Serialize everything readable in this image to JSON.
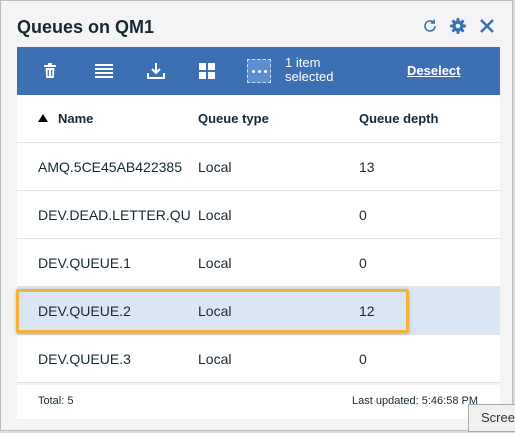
{
  "panel": {
    "title": "Queues on QM1",
    "icons": {
      "refresh": "refresh-icon",
      "settings": "gear-icon",
      "close": "close-icon"
    }
  },
  "toolbar": {
    "selection_text": "1 item selected",
    "deselect_label": "Deselect",
    "icons": [
      "trash-icon",
      "list-icon",
      "download-icon",
      "grid-icon",
      "more-icon"
    ]
  },
  "table": {
    "columns": [
      "Name",
      "Queue type",
      "Queue depth"
    ],
    "rows": [
      {
        "name": "AMQ.5CE45AB422385",
        "type": "Local",
        "depth": "13"
      },
      {
        "name": "DEV.DEAD.LETTER.QU",
        "type": "Local",
        "depth": "0"
      },
      {
        "name": "DEV.QUEUE.1",
        "type": "Local",
        "depth": "0"
      },
      {
        "name": "DEV.QUEUE.2",
        "type": "Local",
        "depth": "12",
        "selected": true
      },
      {
        "name": "DEV.QUEUE.3",
        "type": "Local",
        "depth": "0"
      }
    ]
  },
  "footer": {
    "total": "Total: 5",
    "last_updated": "Last updated: 5:46:58 PM"
  },
  "tooltip": {
    "text": "Scree"
  },
  "colors": {
    "toolbar": "#3d70b2",
    "selected_row": "#dbe6f4",
    "highlight": "#f3b33a"
  }
}
